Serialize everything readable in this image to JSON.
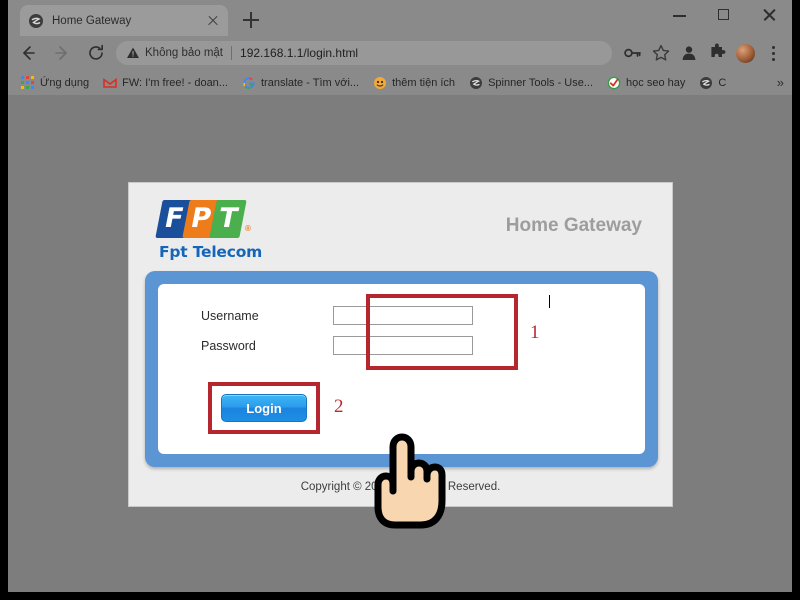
{
  "browser": {
    "tab": {
      "title": "Home Gateway",
      "favicon": "globe-icon",
      "close": "×"
    },
    "new_tab_label": "+",
    "window_controls": {
      "minimize": "minimize-icon",
      "maximize": "maximize-icon",
      "close": "close-icon"
    },
    "nav": {
      "back": "back-arrow-icon",
      "forward": "forward-arrow-icon",
      "reload": "reload-icon"
    },
    "omnibox": {
      "security_warning_icon": "warning-triangle-icon",
      "security_text": "Không bảo mật",
      "url": "192.168.1.1/login.html"
    },
    "toolbar_icons": [
      {
        "name": "key-icon",
        "glyph": "key"
      },
      {
        "name": "bookmark-star-icon",
        "glyph": "star"
      },
      {
        "name": "profile-icon",
        "glyph": "person"
      },
      {
        "name": "extensions-puzzle-icon",
        "glyph": "puzzle"
      },
      {
        "name": "avatar",
        "glyph": "avatar"
      },
      {
        "name": "chrome-menu-icon",
        "glyph": "kebab"
      }
    ],
    "bookmarks": [
      {
        "label": "Ứng dụng",
        "icon": "apps-grid-icon"
      },
      {
        "label": "FW: I'm free! - doan...",
        "icon": "gmail-icon"
      },
      {
        "label": "translate - Tìm với...",
        "icon": "google-icon"
      },
      {
        "label": "thêm tiện ích",
        "icon": "smiley-icon"
      },
      {
        "label": "Spinner Tools - Use...",
        "icon": "globe-icon"
      },
      {
        "label": "học seo hay",
        "icon": "check-circle-icon"
      },
      {
        "label": "C",
        "icon": "globe-icon"
      }
    ],
    "bookmarks_overflow": "»"
  },
  "page": {
    "header": {
      "logo": {
        "letters": [
          "F",
          "P",
          "T"
        ],
        "registered_mark": "®",
        "wordmark": "Fpt Telecom",
        "colors": {
          "f": "#1a4f9c",
          "p": "#ef7c1a",
          "t": "#4aaf4c",
          "wordmark": "#1565b8"
        }
      },
      "title": "Home Gateway"
    },
    "form": {
      "panel_color": "#5b95d4",
      "fields": [
        {
          "label": "Username",
          "value": "",
          "placeholder": "",
          "type": "text",
          "focused": true
        },
        {
          "label": "Password",
          "value": "",
          "placeholder": "",
          "type": "password",
          "focused": false
        }
      ],
      "submit_label": "Login"
    },
    "annotations": [
      {
        "number": "1",
        "target": "input-fields",
        "color": "#b5262f"
      },
      {
        "number": "2",
        "target": "login-button",
        "color": "#b5262f"
      }
    ],
    "footer": {
      "copyright": "Copyright © 2020,                All Rights Reserved."
    },
    "cursor": "pointing-hand-cursor"
  }
}
